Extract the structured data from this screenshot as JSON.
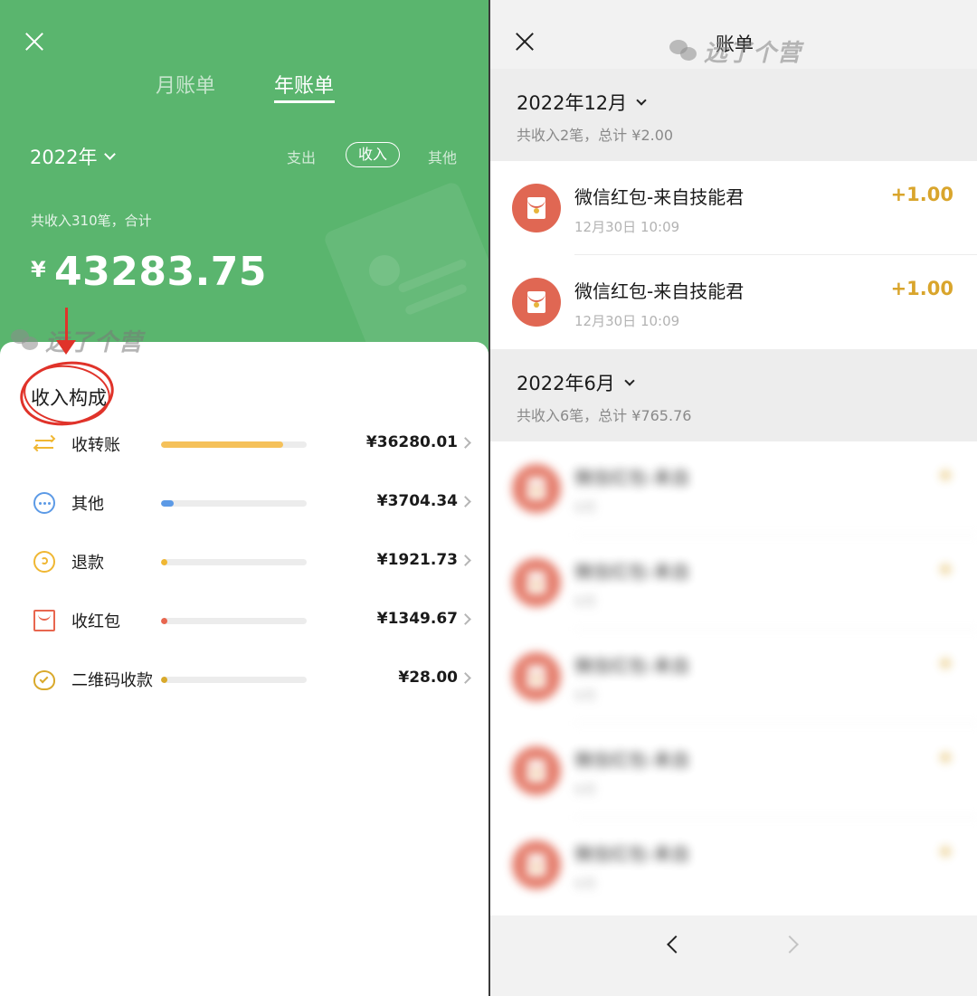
{
  "left": {
    "tabs": {
      "month": "月账单",
      "year": "年账单"
    },
    "year_selector": "2022年",
    "filters": {
      "expense": "支出",
      "income": "收入",
      "other": "其他"
    },
    "summary_label": "共收入310笔，合计",
    "currency_symbol": "¥",
    "total": "43283.75",
    "watermark": "远了个营",
    "section_title": "收入构成",
    "accent_color": "#5ab56e",
    "items": [
      {
        "label": "收转账",
        "amount": "¥36280.01",
        "share": 0.838,
        "color": "#f5c15a",
        "icon": "transfer-icon"
      },
      {
        "label": "其他",
        "amount": "¥3704.34",
        "share": 0.086,
        "color": "#5c9ae6",
        "icon": "more-dots-icon"
      },
      {
        "label": "退款",
        "amount": "¥1921.73",
        "share": 0.044,
        "color": "#f0b733",
        "icon": "refund-icon"
      },
      {
        "label": "收红包",
        "amount": "¥1349.67",
        "share": 0.031,
        "color": "#e8664f",
        "icon": "red-packet-icon"
      },
      {
        "label": "二维码收款",
        "amount": "¥28.00",
        "share": 0.001,
        "color": "#d9a92b",
        "icon": "money-bag-icon"
      }
    ]
  },
  "right": {
    "title": "账单",
    "watermark": "远了个营",
    "months": [
      {
        "title": "2022年12月",
        "summary": "共收入2笔，总计 ¥2.00",
        "transactions": [
          {
            "name": "微信红包-来自技能君",
            "time": "12月30日 10:09",
            "amount": "+1.00"
          },
          {
            "name": "微信红包-来自技能君",
            "time": "12月30日 10:09",
            "amount": "+1.00"
          }
        ]
      },
      {
        "title": "2022年6月",
        "summary": "共收入6笔，总计 ¥765.76",
        "transactions": [
          {
            "name": "微信红包-来自",
            "time": "6月",
            "amount": "+"
          },
          {
            "name": "微信红包-来自",
            "time": "6月",
            "amount": "+"
          },
          {
            "name": "微信红包-来自",
            "time": "6月",
            "amount": "+"
          },
          {
            "name": "微信红包-来自",
            "time": "6月",
            "amount": "+"
          },
          {
            "name": "微信红包-来自",
            "time": "6月",
            "amount": "+"
          }
        ]
      }
    ],
    "amount_color": "#d9a52c",
    "avatar_color": "#e06753"
  }
}
